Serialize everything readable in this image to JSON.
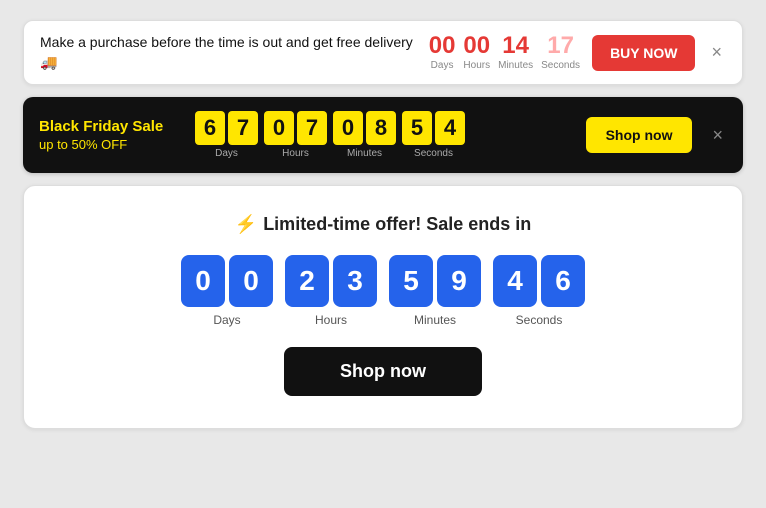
{
  "banner1": {
    "text": "Make a purchase before the time is out and get free delivery 🚚",
    "countdown": {
      "days": {
        "value": "00",
        "label": "Days"
      },
      "hours": {
        "value": "00",
        "label": "Hours"
      },
      "minutes": {
        "value": "14",
        "label": "Minutes"
      },
      "seconds": {
        "value": "17",
        "label": "Seconds",
        "faded": true
      }
    },
    "buy_btn": "BUY NOW",
    "close_icon": "×"
  },
  "banner2": {
    "title": "Black Friday Sale",
    "subtitle": "up to 50% OFF",
    "countdown": {
      "days": {
        "d1": "6",
        "d2": "7",
        "label": "Days"
      },
      "hours": {
        "d1": "0",
        "d2": "7",
        "label": "Hours"
      },
      "minutes": {
        "d1": "0",
        "d2": "8",
        "label": "Minutes"
      },
      "seconds": {
        "d1": "5",
        "d2": "4",
        "label": "Seconds"
      }
    },
    "shop_btn": "Shop now",
    "close_icon": "×"
  },
  "banner3": {
    "title_icon": "⚡",
    "title": "Limited-time offer! Sale ends in",
    "countdown": {
      "days": {
        "d1": "0",
        "d2": "0",
        "label": "Days"
      },
      "hours": {
        "d1": "2",
        "d2": "3",
        "label": "Hours"
      },
      "minutes": {
        "d1": "5",
        "d2": "9",
        "label": "Minutes"
      },
      "seconds": {
        "d1": "4",
        "d2": "6",
        "label": "Seconds"
      }
    },
    "shop_btn": "Shop now"
  }
}
